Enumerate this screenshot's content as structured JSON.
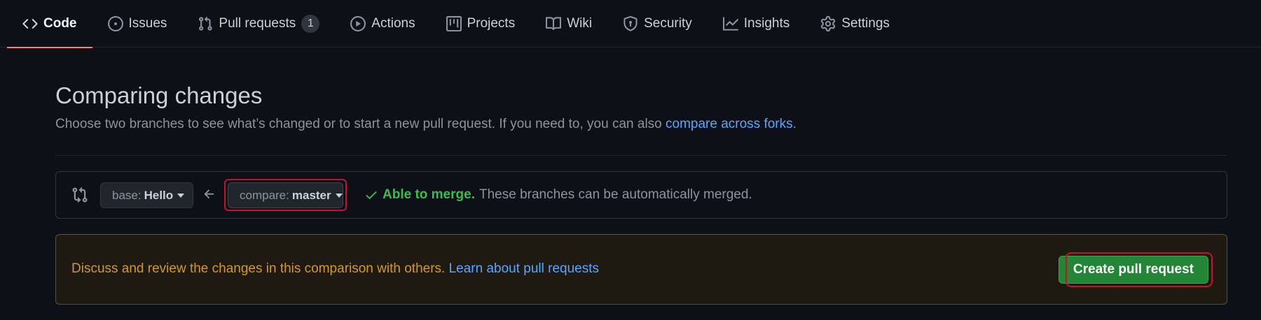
{
  "nav": {
    "tabs": [
      {
        "label": "Code",
        "icon": "code-icon",
        "selected": true
      },
      {
        "label": "Issues",
        "icon": "issue-opened-icon"
      },
      {
        "label": "Pull requests",
        "icon": "git-pull-request-icon",
        "counter": "1"
      },
      {
        "label": "Actions",
        "icon": "play-icon"
      },
      {
        "label": "Projects",
        "icon": "table-icon"
      },
      {
        "label": "Wiki",
        "icon": "book-icon"
      },
      {
        "label": "Security",
        "icon": "shield-icon"
      },
      {
        "label": "Insights",
        "icon": "graph-icon"
      },
      {
        "label": "Settings",
        "icon": "gear-icon"
      }
    ]
  },
  "page": {
    "title": "Comparing changes",
    "description": "Choose two branches to see what’s changed or to start a new pull request. If you need to, you can also ",
    "description_link": "compare across forks",
    "description_end": "."
  },
  "range": {
    "compare_icon": "git-compare-icon",
    "base_label": "base:",
    "base_value": "Hello",
    "arrow_icon": "arrow-left-icon",
    "compare_label": "compare:",
    "compare_value": "master",
    "merge_ok": "Able to merge.",
    "merge_msg": "These branches can be automatically merged."
  },
  "callout": {
    "message": "Discuss and review the changes in this comparison with others. ",
    "link": "Learn about pull requests",
    "button": "Create pull request"
  },
  "colors": {
    "background": "#0d1117",
    "accent_link": "#58a6ff",
    "success": "#3fb950",
    "button_green": "#238636",
    "warning_text": "#d29922",
    "selected_tab_underline": "#f78166",
    "annotation": "#c8102e"
  }
}
